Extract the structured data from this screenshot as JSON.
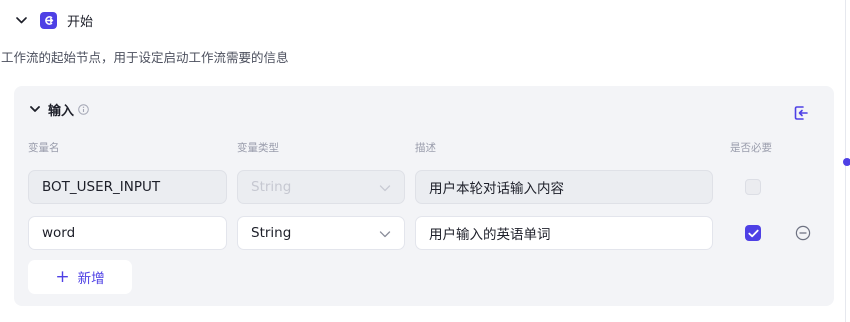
{
  "node": {
    "title": "开始",
    "description": "工作流的起始节点，用于设定启动工作流需要的信息"
  },
  "input_section": {
    "title": "输入",
    "columns": {
      "name": "变量名",
      "type": "变量类型",
      "description": "描述",
      "required": "是否必要"
    },
    "rows": [
      {
        "name": "BOT_USER_INPUT",
        "type": "String",
        "description": "用户本轮对话输入内容",
        "required": false,
        "editable": false
      },
      {
        "name": "word",
        "type": "String",
        "description": "用户输入的英语单词",
        "required": true,
        "editable": true
      }
    ],
    "add_label": "新增",
    "add_icon": "+"
  },
  "colors": {
    "accent": "#4e40e5",
    "card_bg": "#f3f4f7"
  }
}
